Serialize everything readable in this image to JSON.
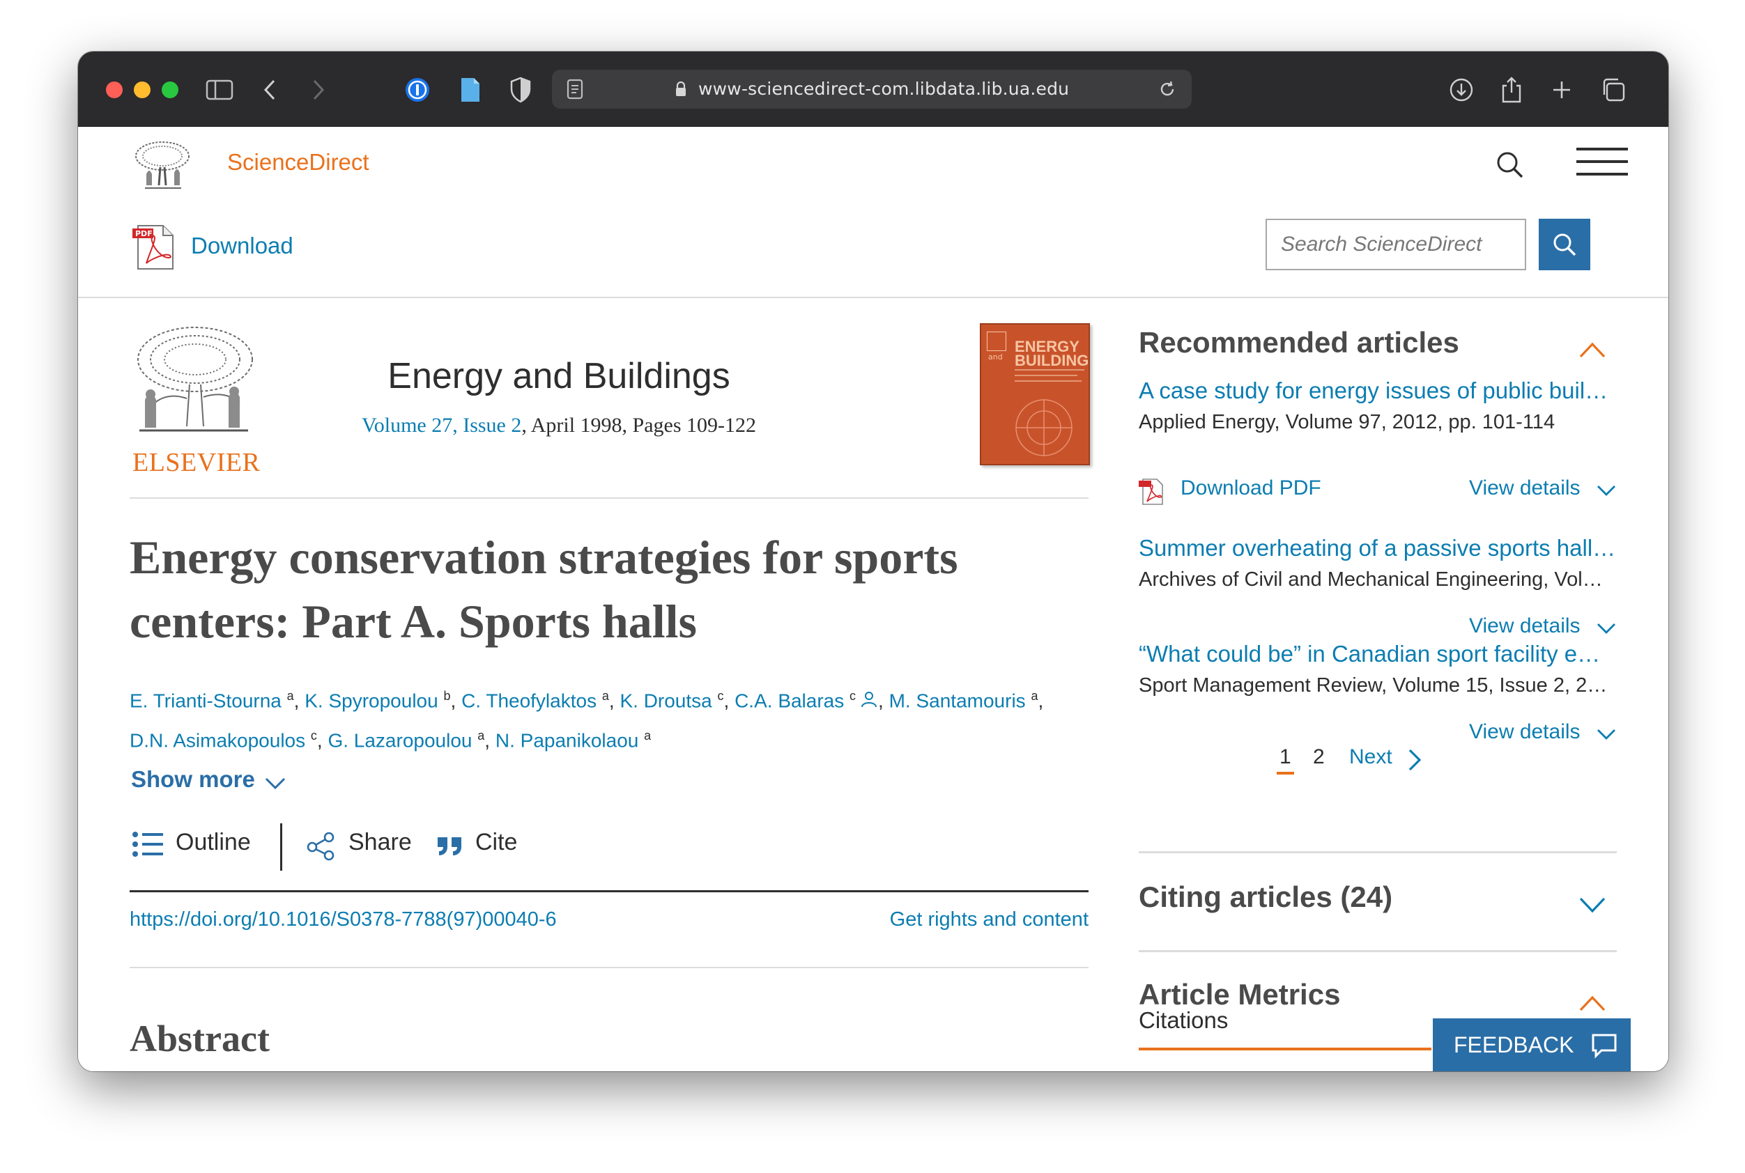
{
  "browser": {
    "url": "www-sciencedirect-com.libdata.lib.ua.edu"
  },
  "header": {
    "brand": "ScienceDirect",
    "download_label": "Download",
    "search_placeholder": "Search ScienceDirect"
  },
  "journal": {
    "publisher": "ELSEVIER",
    "title": "Energy and Buildings",
    "volume_issue": "Volume 27, Issue 2",
    "date_pages": ", April 1998, Pages 109-122",
    "cover_title_line1": "ENERGY",
    "cover_title_line2": "BUILDINGS",
    "cover_and": "and"
  },
  "article": {
    "title": "Energy conservation strategies for sports centers: Part A. Sports halls",
    "authors": [
      {
        "name": "E. Trianti-Stourna",
        "aff": "a"
      },
      {
        "name": "K. Spyropoulou",
        "aff": "b"
      },
      {
        "name": "C. Theofylaktos",
        "aff": "a"
      },
      {
        "name": "K. Droutsa",
        "aff": "c"
      },
      {
        "name": "C.A. Balaras",
        "aff": "c"
      },
      {
        "name": "M. Santamouris",
        "aff": "a"
      },
      {
        "name": "D.N. Asimakopoulos",
        "aff": "c"
      },
      {
        "name": "G. Lazaropoulou",
        "aff": "a"
      },
      {
        "name": "N. Papanikolaou",
        "aff": "a"
      }
    ],
    "show_more": "Show more",
    "toolbar": {
      "outline": "Outline",
      "share": "Share",
      "cite": "Cite"
    },
    "doi": "https://doi.org/10.1016/S0378-7788(97)00040-6",
    "rights": "Get rights and content",
    "abstract_heading": "Abstract"
  },
  "sidebar": {
    "recommended_title": "Recommended articles",
    "recommended": [
      {
        "title": "A case study for energy issues of public buil…",
        "source": "Applied Energy, Volume 97, 2012, pp. 101-114",
        "download": "Download PDF",
        "view_details": "View details"
      },
      {
        "title": "Summer overheating of a passive sports hall…",
        "source": "Archives of Civil and Mechanical Engineering, Vol…",
        "view_details": "View details"
      },
      {
        "title": "“What could be” in Canadian sport facility e…",
        "source": "Sport Management Review, Volume 15, Issue 2, 2…",
        "view_details": "View details"
      }
    ],
    "pagination": {
      "current": "1",
      "page2": "2",
      "next": "Next"
    },
    "citing_title": "Citing articles (24)",
    "metrics_title": "Article Metrics",
    "citations_label": "Citations",
    "feedback_label": "FEEDBACK"
  }
}
